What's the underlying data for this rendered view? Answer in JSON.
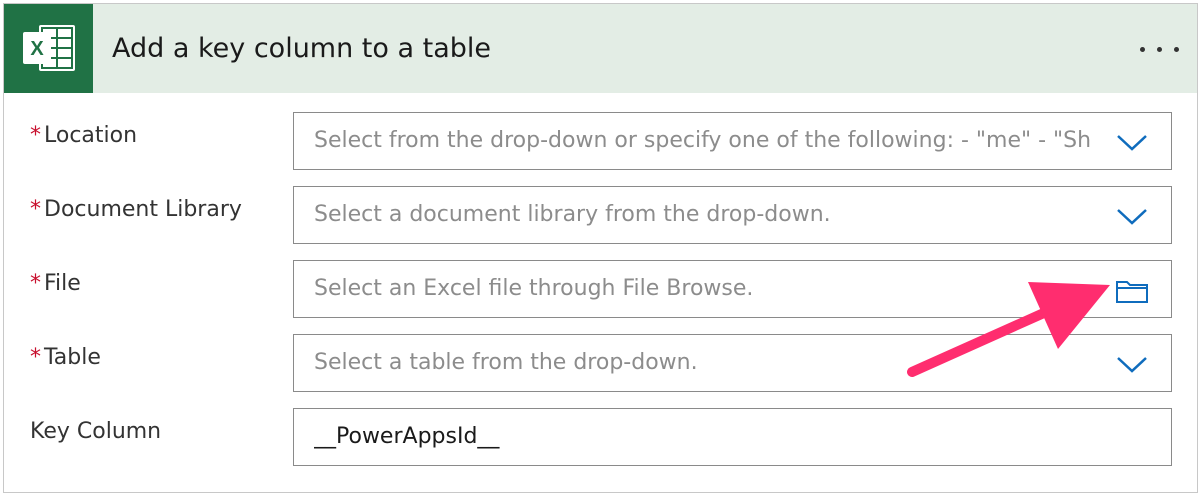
{
  "card": {
    "title": "Add a key column to a table",
    "app_icon": "excel-icon",
    "menu_icon": "more-options-icon"
  },
  "fields": {
    "location": {
      "label": "Location",
      "required": "*",
      "placeholder": "Select from the drop-down or specify one of the following: - \"me\" - \"SharePoint Site URL\"",
      "control_icon": "chevron-down-icon"
    },
    "document_library": {
      "label": "Document Library",
      "required": "*",
      "placeholder": "Select a document library from the drop-down.",
      "control_icon": "chevron-down-icon"
    },
    "file": {
      "label": "File",
      "required": "*",
      "placeholder": "Select an Excel file through File Browse.",
      "control_icon": "folder-icon"
    },
    "table": {
      "label": "Table",
      "required": "*",
      "placeholder": "Select a table from the drop-down.",
      "control_icon": "chevron-down-icon"
    },
    "key_column": {
      "label": "Key Column",
      "value": "__PowerAppsId__"
    }
  },
  "colors": {
    "header_bg": "#e3ede5",
    "excel_green": "#207245",
    "required_red": "#c8102e",
    "control_blue": "#0f6cbd",
    "annotation_arrow": "#ff2d6f"
  },
  "annotation": {
    "type": "arrow",
    "points_to": "folder-icon"
  }
}
